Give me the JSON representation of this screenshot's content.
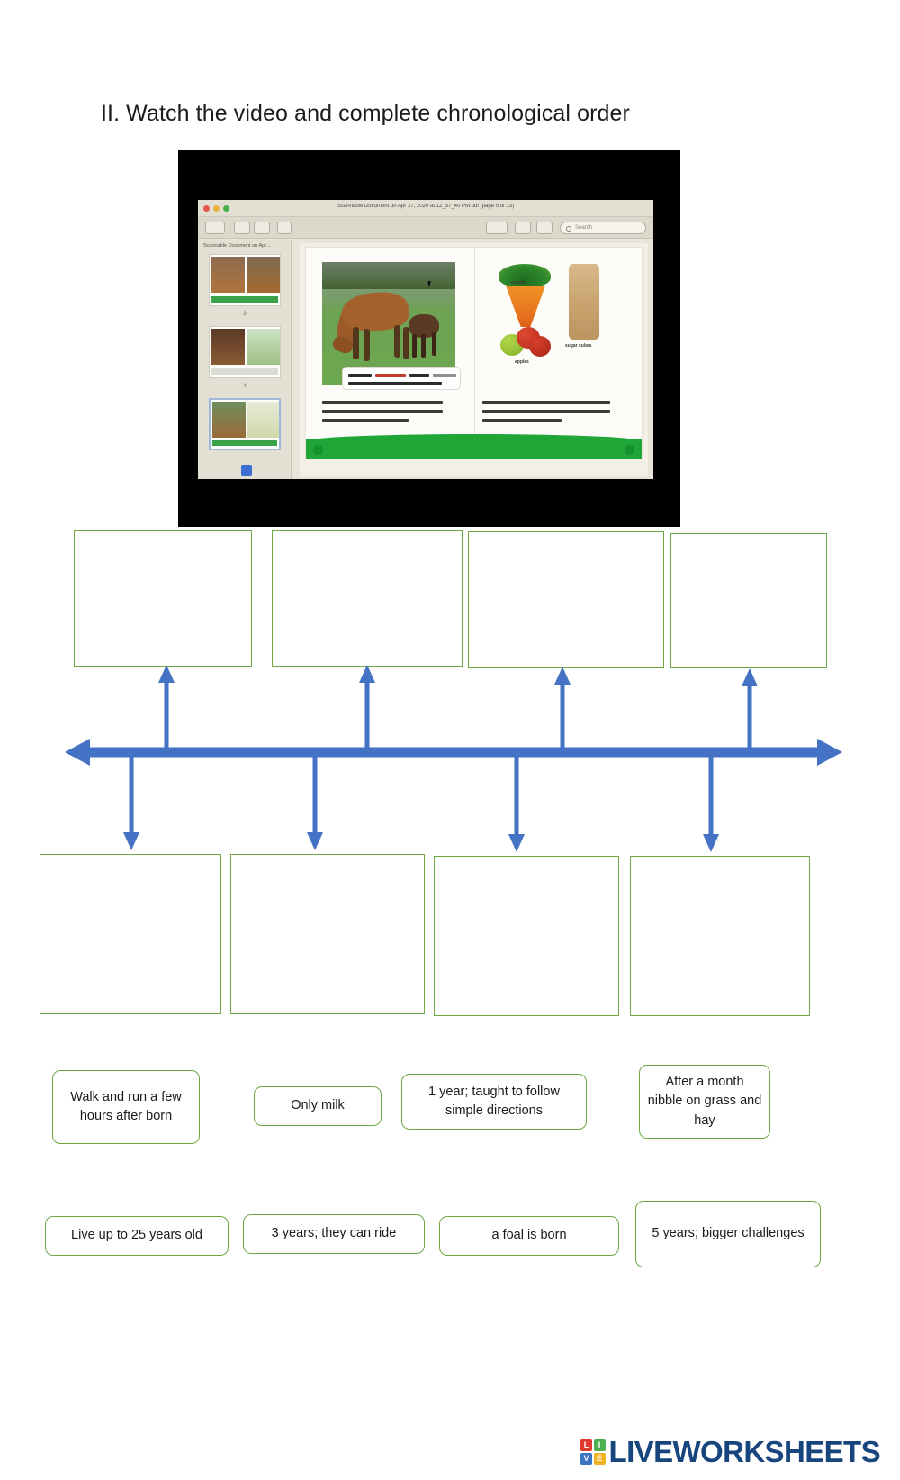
{
  "title": "II. Watch the video and complete chronological order",
  "video": {
    "name": "video-thumbnail",
    "window_title": "Scannable Document on Apr 27, 2020 at 12_37_40 PM.pdf (page 5 of 13)",
    "sidebar_title": "Scannable Document on Apr...",
    "search_placeholder": "Search",
    "thumbnail_numbers": [
      "3",
      "4"
    ],
    "book_text_left": "At first, foals only drink milk from their mother's. But within a month, they begin to nibble on grass and hay.",
    "book_text_right": "When horses are a little older, they are ready for special treats like carrots and apples. They also like sugar cubes.",
    "book_caption": "Horses are herbivores. That means they eat plants, but not meat.",
    "labels": {
      "carrots": "carrots",
      "apples": "apples",
      "sugar_cubes": "sugar cubes"
    }
  },
  "timeline": {
    "color": "#4472c4",
    "top_boxes": [
      {
        "label": "",
        "value": ""
      },
      {
        "label": "",
        "value": ""
      },
      {
        "label": "",
        "value": ""
      },
      {
        "label": "",
        "value": ""
      }
    ],
    "bottom_boxes": [
      {
        "label": "",
        "value": ""
      },
      {
        "label": "",
        "value": ""
      },
      {
        "label": "",
        "value": ""
      },
      {
        "label": "",
        "value": ""
      }
    ]
  },
  "options": {
    "border_color": "#6ea844",
    "row1": [
      "Walk and run a few hours after born",
      "Only milk",
      "1 year; taught to follow simple directions",
      "After a month nibble on grass and hay"
    ],
    "row2": [
      "Live up to 25 years old",
      "3 years; they can ride",
      "a foal is born",
      "5 years; bigger challenges"
    ]
  },
  "footer": {
    "brand": "LIVEWORKSHEETS",
    "tiles": [
      "L",
      "I",
      "V",
      "E"
    ],
    "tile_colors": [
      "#e03a2f",
      "#4caf50",
      "#3b73c4",
      "#f0b323"
    ],
    "brand_color": "#17457e"
  }
}
